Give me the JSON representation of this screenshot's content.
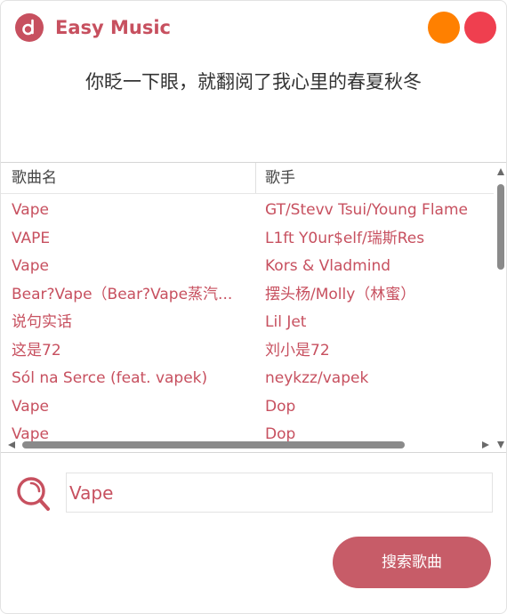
{
  "app": {
    "title": "Easy Music",
    "logo_icon": "music-disc-icon",
    "accent_color": "#c7505f"
  },
  "window_controls": {
    "minimize_color": "#ff8000",
    "close_color": "#ef3f4f"
  },
  "lyric": "你眨一下眼，就翻阅了我心里的春夏秋冬",
  "table": {
    "headers": {
      "song": "歌曲名",
      "artist": "歌手"
    },
    "rows": [
      {
        "song": "Vape",
        "artist": "GT/Stevv Tsui/Young Flame"
      },
      {
        "song": "VAPE",
        "artist": "L1ft Y0ur$elf/瑞斯Res"
      },
      {
        "song": "Vape",
        "artist": "Kors & Vladmind"
      },
      {
        "song": "Bear?Vape（Bear?Vape蒸汽...",
        "artist": "摆头杨/Molly（林蜜）"
      },
      {
        "song": "说句实话",
        "artist": "Lil Jet"
      },
      {
        "song": "这是72",
        "artist": "刘小是72"
      },
      {
        "song": "Sól na Serce (feat. vapek)",
        "artist": "neykzz/vapek"
      },
      {
        "song": "Vape",
        "artist": "Dop"
      },
      {
        "song": "Vape",
        "artist": "Dop"
      }
    ]
  },
  "search": {
    "icon": "search-icon",
    "value": "Vape",
    "button_label": "搜索歌曲"
  }
}
